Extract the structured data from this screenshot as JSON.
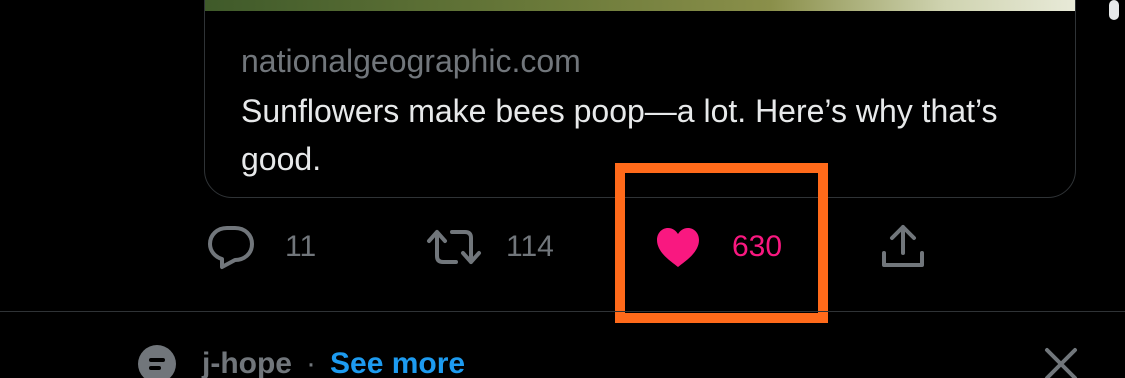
{
  "link_card": {
    "domain": "nationalgeographic.com",
    "title": "Sunflowers make bees poop—a lot. Here’s why that’s good."
  },
  "actions": {
    "reply_count": "11",
    "retweet_count": "114",
    "like_count": "630",
    "like_state": "liked"
  },
  "footer": {
    "icon": "list-icon",
    "name": "j-hope",
    "separator": "·",
    "link": "See more"
  },
  "colors": {
    "background": "#000000",
    "muted": "#71767b",
    "like": "#f91880",
    "link": "#1d9bf0",
    "highlight": "#ff6a1a"
  }
}
